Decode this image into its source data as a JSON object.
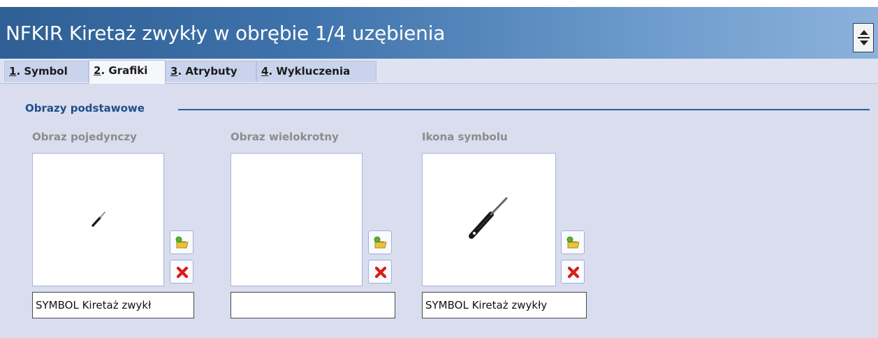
{
  "window": {
    "title": "NFKIR Kiretaż zwykły w obrębie 1/4 uzębienia"
  },
  "tabs": [
    {
      "key": "1",
      "rest": ". Symbol",
      "active": false
    },
    {
      "key": "2",
      "rest": ". Grafiki",
      "active": true
    },
    {
      "key": "3",
      "rest": ". Atrybuty",
      "active": false
    },
    {
      "key": "4",
      "rest": ". Wykluczenia",
      "active": false
    }
  ],
  "section": {
    "title": "Obrazy podstawowe"
  },
  "images": [
    {
      "label": "Obraz pojedynczy",
      "field_value": "SYMBOL Kiretaż zwykł",
      "icon": "curette-small-icon"
    },
    {
      "label": "Obraz wielokrotny",
      "field_value": "",
      "icon": ""
    },
    {
      "label": "Ikona symbolu",
      "field_value": "SYMBOL Kiretaż zwykły",
      "icon": "curette-large-icon"
    }
  ],
  "buttons": {
    "open_icon": "open-folder-icon",
    "delete_icon": "delete-x-icon"
  },
  "colors": {
    "title_bar_start": "#2f5f95",
    "title_bar_end": "#8cb2db",
    "section_title": "#1f4e8b",
    "content_bg": "#d9ddee",
    "delete_red": "#d91e18"
  }
}
